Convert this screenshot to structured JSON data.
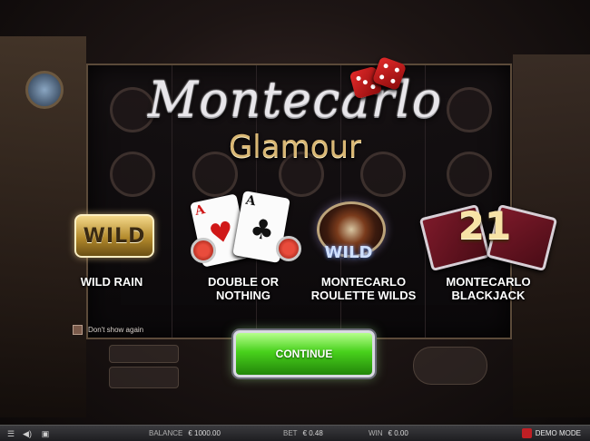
{
  "logo": {
    "script_title": "Montecarlo",
    "subtitle": "Glamour"
  },
  "features": [
    {
      "badge": "WILD",
      "label": "WILD RAIN"
    },
    {
      "label": "DOUBLE OR NOTHING",
      "card1_rank": "A",
      "card1_suit": "♥",
      "card2_rank": "A",
      "card2_suit": "♣"
    },
    {
      "badge": "WILD",
      "label": "MONTECARLO ROULETTE WILDS"
    },
    {
      "badge": "21",
      "label": "MONTECARLO BLACKJACK"
    }
  ],
  "dont_show_again": "Don't show again",
  "continue_label": "CONTINUE",
  "status_bar": {
    "balance_label": "BALANCE",
    "balance_value": "€ 1000.00",
    "bet_label": "BET",
    "bet_value": "€ 0.48",
    "win_label": "WIN",
    "win_value": "€ 0.00",
    "mode": "DEMO MODE"
  },
  "icons": [
    "menu-icon",
    "sound-icon",
    "settings-icon",
    "demo-mode-icon",
    "dice-icon"
  ],
  "colors": {
    "continue_green": "#48d11c",
    "gold": "#d9b774",
    "demo_red": "#c01f24"
  }
}
